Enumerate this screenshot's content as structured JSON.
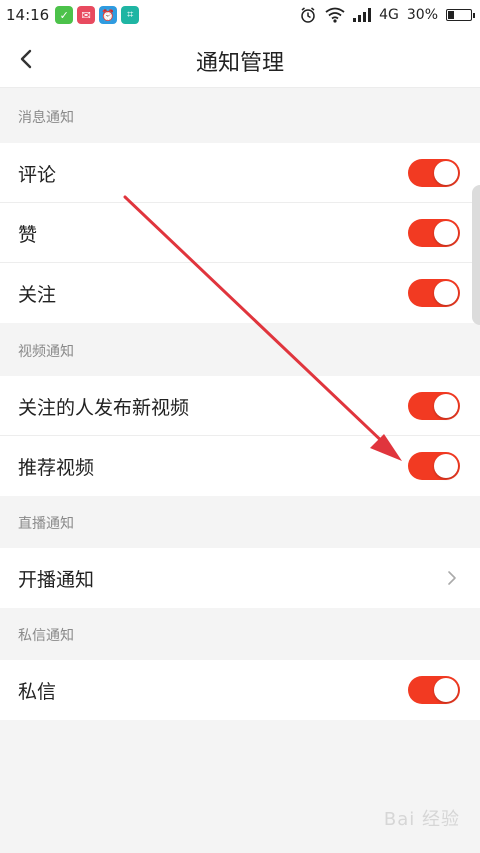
{
  "status_bar": {
    "time": "14:16",
    "network": "4G",
    "battery_percent": "30%",
    "battery_level": 0.3
  },
  "header": {
    "title": "通知管理"
  },
  "sections": {
    "message": {
      "label": "消息通知",
      "items": [
        {
          "label": "评论",
          "enabled": true
        },
        {
          "label": "赞",
          "enabled": true
        },
        {
          "label": "关注",
          "enabled": true
        }
      ]
    },
    "video": {
      "label": "视频通知",
      "items": [
        {
          "label": "关注的人发布新视频",
          "enabled": true
        },
        {
          "label": "推荐视频",
          "enabled": true
        }
      ]
    },
    "live": {
      "label": "直播通知",
      "items": [
        {
          "label": "开播通知"
        }
      ]
    },
    "private": {
      "label": "私信通知",
      "items": [
        {
          "label": "私信",
          "enabled": true
        }
      ]
    }
  },
  "colors": {
    "toggle_on": "#f23a22",
    "annotation_arrow": "#e0353d"
  },
  "watermark": "Bai 经验"
}
